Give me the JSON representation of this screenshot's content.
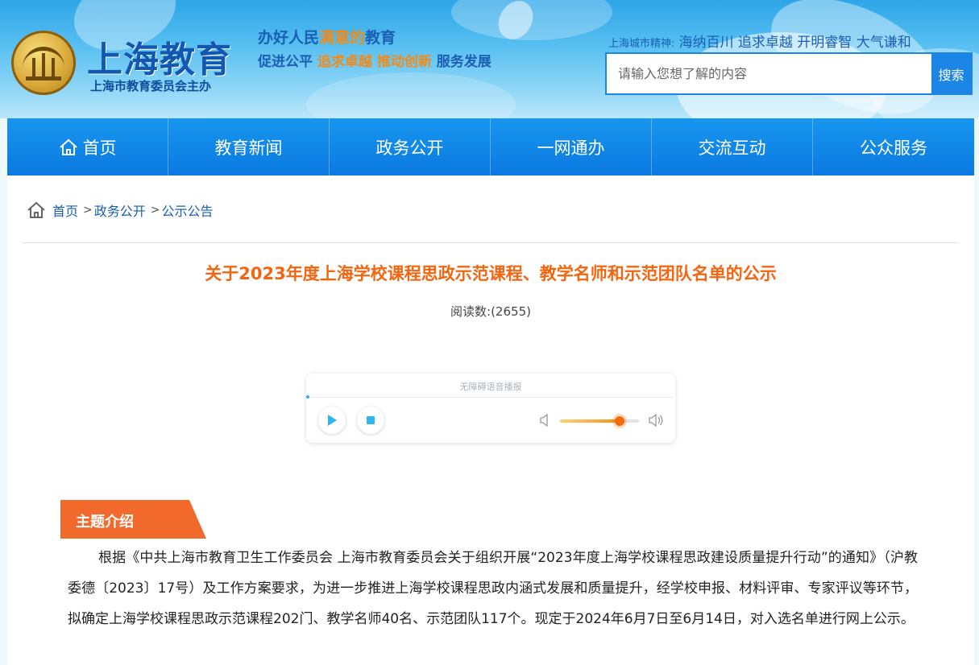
{
  "header": {
    "logo_title": "上海教育",
    "logo_subtitle": "上海市教育委员会主办",
    "slogan_line1_part1": "办好人民",
    "slogan_line1_highlight": "满意的",
    "slogan_line1_part2": "教育",
    "slogan_line2_part1": "促进公平 ",
    "slogan_line2_highlight": "追求卓越 推动创新",
    "slogan_line2_part2": " 服务发展",
    "city_spirit_label": "上海城市精神:",
    "city_spirit_text": "海纳百川 追求卓越 开明睿智 大气谦和",
    "search_placeholder": "请输入您想了解的内容",
    "search_button": "搜索"
  },
  "nav": {
    "items": [
      "首页",
      "教育新闻",
      "政务公开",
      "一网通办",
      "交流互动",
      "公众服务"
    ]
  },
  "breadcrumb": {
    "home": "首页",
    "level1": "政务公开",
    "level2": "公示公告",
    "separator": ">"
  },
  "article": {
    "title": "关于2023年度上海学校课程思政示范课程、教学名师和示范团队名单的公示",
    "read_count": "阅读数:(2655)",
    "section_title": "主题介绍",
    "body": "根据《中共上海市教育卫生工作委员会 上海市教育委员会关于组织开展“2023年度上海学校课程思政建设质量提升行动”的通知》（沪教委德〔2023〕17号）及工作方案要求，为进一步推进上海学校课程思政内涵式发展和质量提升，经学校申报、材料评审、专家评议等环节，拟确定上海学校课程思政示范课程202门、教学名师40名、示范团队117个。现定于2024年6月7日至6月14日，对入选名单进行网上公示。"
  },
  "player": {
    "label": "无障碍语音播报",
    "volume": 0.75,
    "accent_color": "#f36b10",
    "play_color": "#2fb5f0"
  },
  "colors": {
    "brand_blue": "#1b86e6",
    "title_orange": "#f4650f",
    "tag_orange": "#f26a2b"
  },
  "icons": {
    "nav_home": "home-icon",
    "breadcrumb_home": "home-icon",
    "play": "play-icon",
    "stop": "stop-icon",
    "volume_low": "volume-low-icon",
    "volume_high": "volume-high-icon"
  }
}
